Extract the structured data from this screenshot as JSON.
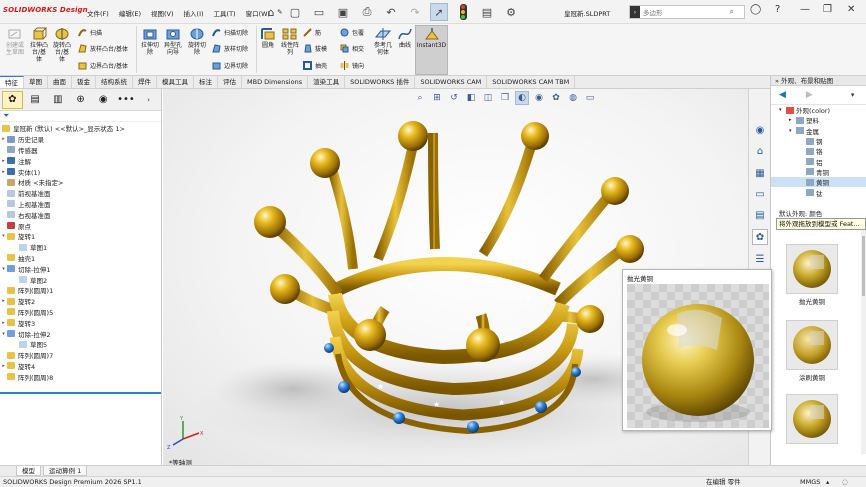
{
  "titlebar": {
    "logo": "SOLIDWORKS Design",
    "menus": [
      "文件(F)",
      "编辑(E)",
      "视图(V)",
      "插入(I)",
      "工具(T)",
      "窗口(W)"
    ],
    "document_title": "皇冠新.SLDPRT",
    "search_placeholder": "多边形",
    "search_scope_icon": "solidworks-help-icon"
  },
  "ribbon": {
    "buttons": [
      {
        "label": "创建或\n生草图"
      },
      {
        "label": "拉伸凸\n台/基\n体"
      },
      {
        "label": "旋转凸\n台/基\n体"
      },
      {
        "label": "扫描"
      },
      {
        "label": "放样凸台/基体"
      },
      {
        "label": "边界凸台/基体"
      },
      {
        "label": "拉伸切\n除"
      },
      {
        "label": "异型孔\n向导"
      },
      {
        "label": "旋转切\n除"
      },
      {
        "label": "扫描切除"
      },
      {
        "label": "放样切除"
      },
      {
        "label": "边界切除"
      },
      {
        "label": "圆角"
      },
      {
        "label": "线性阵\n列"
      },
      {
        "label": "筋"
      },
      {
        "label": "拔模"
      },
      {
        "label": "抽壳"
      },
      {
        "label": "包覆"
      },
      {
        "label": "相交"
      },
      {
        "label": "镜向"
      },
      {
        "label": "参考几\n何体"
      },
      {
        "label": "曲线"
      },
      {
        "label": "Instant3D"
      }
    ]
  },
  "tabs": [
    "特征",
    "草图",
    "曲面",
    "钣金",
    "结构系统",
    "焊件",
    "模具工具",
    "标注",
    "评估",
    "MBD Dimensions",
    "渲染工具",
    "SOLIDWORKS 插件",
    "SOLIDWORKS CAM",
    "SOLIDWORKS CAM TBM"
  ],
  "tree": {
    "root": "皇冠新 (默认) <<默认>_显示状态 1>",
    "items": [
      {
        "label": "历史记录",
        "icon": "history-icon",
        "arrow": true
      },
      {
        "label": "传感器",
        "icon": "sensor-icon",
        "arrow": false
      },
      {
        "label": "注解",
        "icon": "annotation-icon",
        "arrow": true
      },
      {
        "label": "实体(1)",
        "icon": "solid-body-icon",
        "arrow": true
      },
      {
        "label": "材质 <未指定>",
        "icon": "material-icon",
        "arrow": false
      },
      {
        "label": "前视基准面",
        "icon": "plane-icon",
        "arrow": false
      },
      {
        "label": "上视基准面",
        "icon": "plane-icon",
        "arrow": false
      },
      {
        "label": "右视基准面",
        "icon": "plane-icon",
        "arrow": false
      },
      {
        "label": "原点",
        "icon": "origin-icon",
        "arrow": false
      },
      {
        "label": "旋转1",
        "icon": "revolve-icon",
        "arrow": true,
        "expanded": true
      },
      {
        "label": "草图1",
        "icon": "sketch-icon",
        "arrow": false,
        "indent": true
      },
      {
        "label": "抽壳1",
        "icon": "shell-icon",
        "arrow": false
      },
      {
        "label": "切除-拉伸1",
        "icon": "cut-extrude-icon",
        "arrow": true,
        "expanded": true
      },
      {
        "label": "草图2",
        "icon": "sketch-icon",
        "arrow": false,
        "indent": true
      },
      {
        "label": "阵列(圆周)1",
        "icon": "pattern-icon",
        "arrow": false
      },
      {
        "label": "旋转2",
        "icon": "revolve-icon",
        "arrow": true
      },
      {
        "label": "阵列(圆周)5",
        "icon": "pattern-icon",
        "arrow": false
      },
      {
        "label": "旋转3",
        "icon": "revolve-icon",
        "arrow": true
      },
      {
        "label": "切除-拉伸2",
        "icon": "cut-extrude-icon",
        "arrow": true,
        "expanded": true
      },
      {
        "label": "草图5",
        "icon": "sketch-icon",
        "arrow": false,
        "indent": true
      },
      {
        "label": "阵列(圆周)7",
        "icon": "pattern-icon",
        "arrow": false
      },
      {
        "label": "旋转4",
        "icon": "revolve-icon",
        "arrow": true
      },
      {
        "label": "阵列(圆周)8",
        "icon": "pattern-icon",
        "arrow": false
      }
    ]
  },
  "viewport": {
    "view_label": "*等轴测",
    "axis_x": "X",
    "axis_y": "Y",
    "axis_z": "Z"
  },
  "taskpane": {
    "header": "外观、布景和贴图",
    "tree": [
      {
        "label": "外观(color)",
        "level": 0
      },
      {
        "label": "塑料",
        "level": 1
      },
      {
        "label": "金属",
        "level": 1
      },
      {
        "label": "钢",
        "level": 2
      },
      {
        "label": "铬",
        "level": 2
      },
      {
        "label": "铝",
        "level": 2
      },
      {
        "label": "青铜",
        "level": 2
      },
      {
        "label": "黄铜",
        "level": 2,
        "selected": true
      },
      {
        "label": "钛",
        "level": 2
      }
    ],
    "default_label": "默认外观: 颜色",
    "tooltip": "将外观拖放到模型或 Feat...",
    "thumbnails": [
      "抛光黄铜",
      "涂刷黄铜",
      ""
    ]
  },
  "preview": {
    "title": "抛光黄铜"
  },
  "bottom_tabs": [
    "模型",
    "运动算例 1"
  ],
  "status": {
    "product": "SOLIDWORKS Design Premium 2026 SP1.1",
    "mode": "在编辑 零件",
    "units": "MMGS"
  }
}
